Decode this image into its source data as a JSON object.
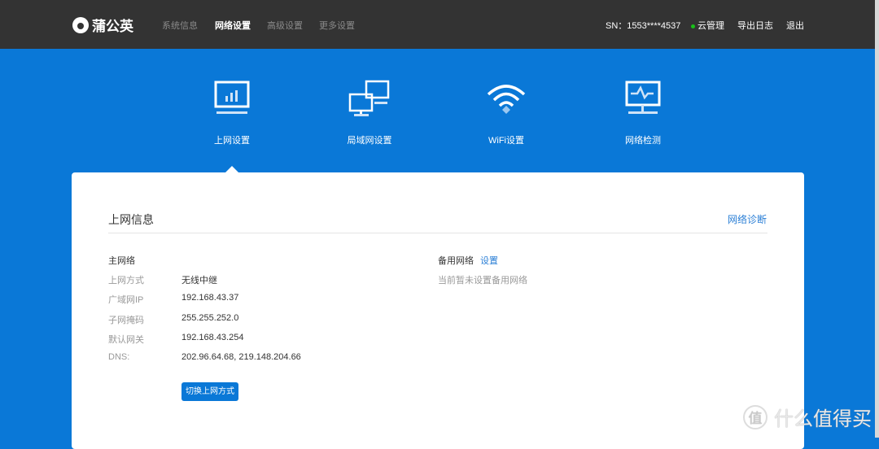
{
  "header": {
    "brand": "蒲公英",
    "nav": [
      "系统信息",
      "网络设置",
      "高级设置",
      "更多设置"
    ],
    "active_nav": 1,
    "sn": "SN：1553****4537",
    "cloud": "云管理",
    "export_log": "导出日志",
    "logout": "退出"
  },
  "tabs": [
    {
      "label": "上网设置",
      "icon": "monitor-chart-icon"
    },
    {
      "label": "局域网设置",
      "icon": "lan-icon"
    },
    {
      "label": "WiFi设置",
      "icon": "wifi-icon"
    },
    {
      "label": "网络检测",
      "icon": "monitor-pulse-icon"
    }
  ],
  "card": {
    "title": "上网信息",
    "diagnose": "网络诊断",
    "main": {
      "heading": "主网络",
      "rows": [
        {
          "label": "上网方式",
          "value": "无线中继"
        },
        {
          "label": "广域网IP",
          "value": "192.168.43.37"
        },
        {
          "label": "子网掩码",
          "value": "255.255.252.0"
        },
        {
          "label": "默认网关",
          "value": "192.168.43.254"
        },
        {
          "label": "DNS:",
          "value": "202.96.64.68, 219.148.204.66"
        }
      ],
      "switch_button": "切换上网方式"
    },
    "backup": {
      "heading": "备用网络",
      "set_link": "设置",
      "status": "当前暂未设置备用网络"
    }
  },
  "watermark": {
    "badge": "值",
    "text": "什么值得买"
  },
  "colors": {
    "header": "#333333",
    "accent": "#0a78d7",
    "link": "#2b7fd6",
    "online": "#19c119"
  }
}
